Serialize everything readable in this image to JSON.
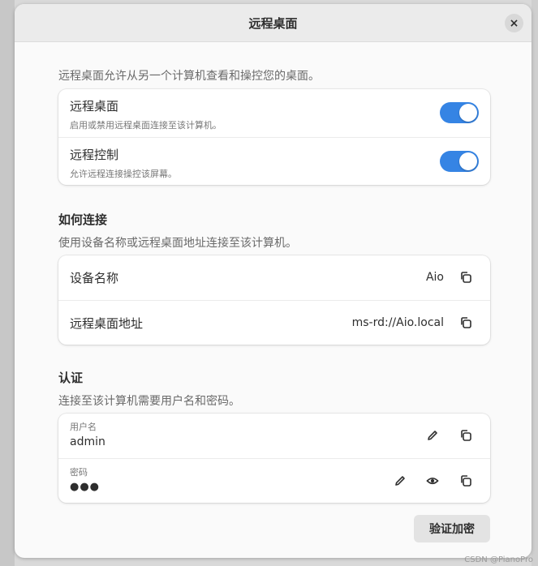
{
  "dialog": {
    "title": "远程桌面",
    "close_symbol": "×",
    "intro": "远程桌面允许从另一个计算机查看和操控您的桌面。"
  },
  "toggles": [
    {
      "title": "远程桌面",
      "subtitle": "启用或禁用远程桌面连接至该计算机。",
      "enabled": true
    },
    {
      "title": "远程控制",
      "subtitle": "允许远程连接操控该屏幕。",
      "enabled": true
    }
  ],
  "connect": {
    "title": "如何连接",
    "description": "使用设备名称或远程桌面地址连接至该计算机。",
    "rows": [
      {
        "label": "设备名称",
        "value": "Aio"
      },
      {
        "label": "远程桌面地址",
        "value": "ms-rd://Aio.local"
      }
    ]
  },
  "auth": {
    "title": "认证",
    "description": "连接至该计算机需要用户名和密码。",
    "username_label": "用户名",
    "username_value": "admin",
    "password_label": "密码",
    "password_value": "●●●",
    "verify_button": "验证加密"
  },
  "watermark": "CSDN @PianoPro",
  "colors": {
    "accent": "#3584e4",
    "dialog_bg": "#fafafa",
    "header_bg": "#ebebeb"
  },
  "icons": [
    "close-icon",
    "copy-icon",
    "edit-icon",
    "eye-icon"
  ]
}
